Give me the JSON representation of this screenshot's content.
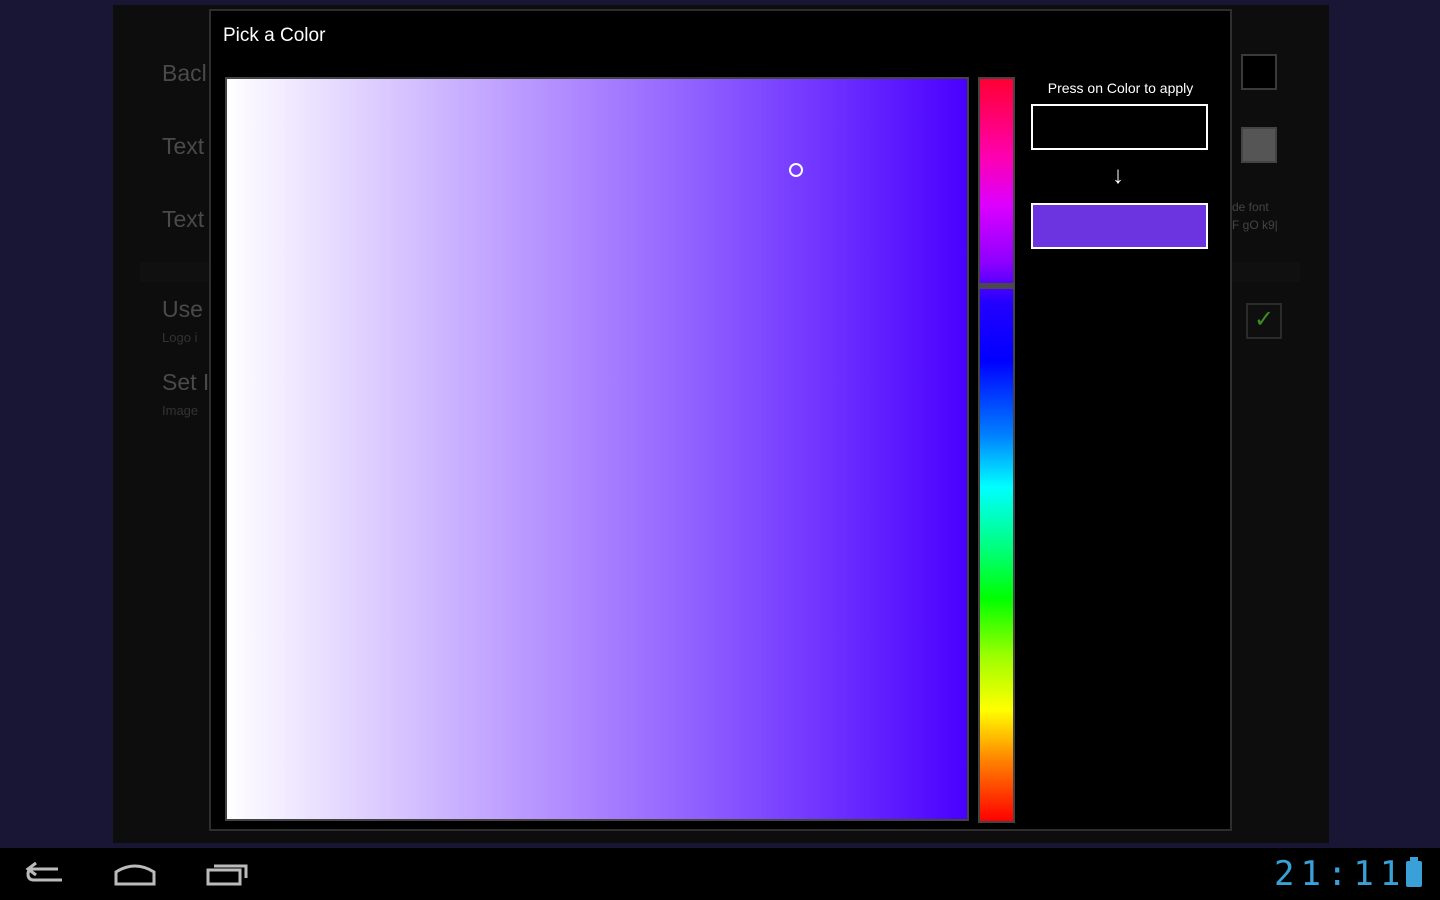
{
  "background": {
    "labels": [
      {
        "text": "Bacl"
      },
      {
        "text": "Text"
      },
      {
        "text": "Text"
      },
      {
        "text": "Use"
      },
      {
        "text": "Logo i"
      },
      {
        "text": "Set I"
      },
      {
        "text": "Image"
      }
    ],
    "right_text_1": "de font",
    "right_text_2": "F gO k9|"
  },
  "dialog": {
    "title": "Pick a Color",
    "apply_label": "Press on Color to apply",
    "arrow": "↓",
    "selected_color": "#6c33e0",
    "previous_color": "#000000"
  },
  "statusbar": {
    "time": "21:11"
  },
  "colors": {
    "accent": "#3aa0d8",
    "dialog_bg": "#000000"
  },
  "icons": [
    "back-icon",
    "home-icon",
    "recent-apps-icon",
    "battery-icon",
    "checkmark-icon"
  ]
}
